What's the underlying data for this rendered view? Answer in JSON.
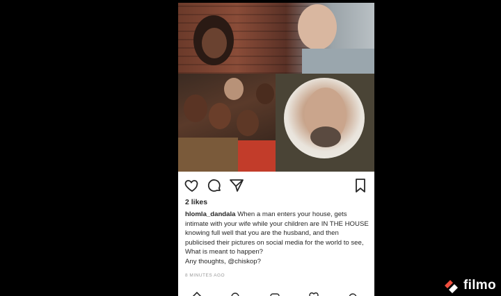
{
  "post": {
    "likes": "2 likes",
    "username": "hlomla_dandala",
    "caption_text": "When a man enters your house, gets intimate with your wife while your children are IN THE HOUSE knowing full well that you are the husband, and then publicised their pictures on social media for the world to see, What is meant to happen?",
    "caption_line2": "Any thoughts, @chiskop?",
    "time": "8 MINUTES AGO"
  },
  "actions": {
    "like_icon": "heart-icon",
    "comment_icon": "comment-icon",
    "share_icon": "send-icon",
    "save_icon": "bookmark-icon"
  },
  "watermark": {
    "text": "filmo"
  },
  "colors": {
    "background": "#000000",
    "text": "#262626",
    "muted": "#999999",
    "brand_watermark": "#f04e3e"
  }
}
